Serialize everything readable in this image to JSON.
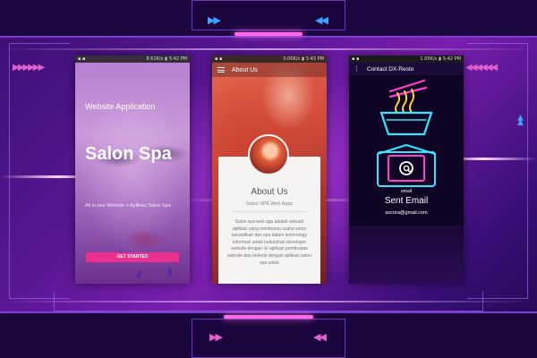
{
  "phone1": {
    "status": {
      "speed": "8.61K/s",
      "time": "5:42 PM"
    },
    "tagline": "Website Application",
    "title": "Salon Spa",
    "description": "All in one Website + Aplikasi Salon Spa",
    "cta_label": "GET STARTED"
  },
  "phone2": {
    "status": {
      "speed": "0.00K/s",
      "time": "5:43 PM"
    },
    "appbar_title": "About Us",
    "card": {
      "title": "About Us",
      "subtitle": "Salon SPA Web Apps",
      "body": "Salon spa web app adalah sebuah aplikasi yang membantu usaha salon kecantikan dan spa dalam technology informasi untuk kebutuhan developer website dengan ini aplikasi pembuatan website dan bekerja dengan aplikasi salon spa untuk"
    }
  },
  "phone3": {
    "status": {
      "speed": "1.00K/s",
      "time": "5:42 PM"
    },
    "appbar_title": "Contact DX-Resto",
    "email_label": "email",
    "email_title": "Sent Email",
    "email_address": "axcora@gmail.com"
  },
  "icons": {
    "menu": "hamburger-menu-icon",
    "overflow": "vertical-dots-icon",
    "noodle": "neon-noodle-bowl-icon",
    "mail": "neon-at-mail-icon"
  },
  "colors": {
    "cta": "#e8308c",
    "neon_cyan": "#33e6ff",
    "neon_pink": "#ff3fd0",
    "neon_yellow": "#ffd23a",
    "background": "#5a1795"
  }
}
